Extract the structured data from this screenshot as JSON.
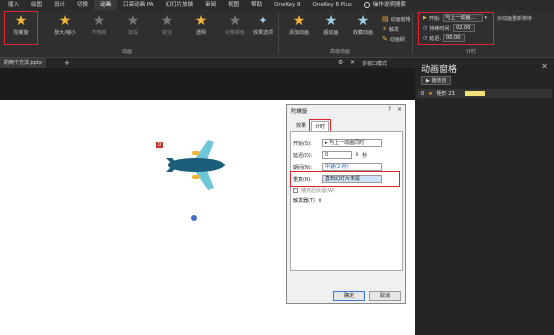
{
  "menubar": {
    "tabs": [
      "插入",
      "绘图",
      "设计",
      "切换",
      "动画",
      "口袋动画 PA",
      "幻灯片放映",
      "审阅",
      "视图",
      "帮助",
      "OneKey 8",
      "OneKey 8 Plus"
    ],
    "active_tab": "动画",
    "search_label": "操作说明搜索"
  },
  "ribbon": {
    "effects": [
      {
        "label": "陀螺旋",
        "state": "selected"
      },
      {
        "label": "放大/缩小",
        "state": "normal"
      },
      {
        "label": "不饱和",
        "state": "dim"
      },
      {
        "label": "加深",
        "state": "dim"
      },
      {
        "label": "变淡",
        "state": "dim"
      },
      {
        "label": "透明",
        "state": "normal"
      },
      {
        "label": "对象颜色",
        "state": "dim"
      }
    ],
    "effect_options_label": "效果选项",
    "group_animation": "动画",
    "add_animation_label": "添加动画",
    "animation_pane_label": "动画窗格",
    "trigger_label": "触发",
    "animation_painter_label": "动画刷",
    "group_advanced": "高级动画",
    "start_label": "开始:",
    "start_value": "与上一动画...",
    "duration_label": "持续时间:",
    "duration_value": "02.00",
    "delay_label": "延迟:",
    "delay_value": "00.00",
    "reorder_label": "对动画重新排序",
    "group_timing": "计时"
  },
  "document": {
    "tab_name": "的两个方法.pptx",
    "add_tab": "+",
    "multi_window_label": "多窗口模式",
    "animation_tag": "0"
  },
  "anim_pane": {
    "title": "动画窗格",
    "play_label": "播放自",
    "item_index": "0",
    "item_name": "矩形 23"
  },
  "dialog": {
    "title": "陀螺旋",
    "help": "?",
    "close": "×",
    "tabs": [
      "效果",
      "计时"
    ],
    "active_tab": "计时",
    "start_label": "开始(S):",
    "start_value": "与上一动画同时",
    "delay_label": "延迟(D):",
    "delay_value": "0",
    "delay_unit": "秒",
    "duration_label": "期间(N):",
    "duration_value": "中速(2 秒)",
    "repeat_label": "重复(R):",
    "repeat_value": "直到幻灯片末尾",
    "rewind_label": "播完后快退(W)",
    "triggers_label": "触发器(T)",
    "ok": "确定",
    "cancel": "取消"
  },
  "colors": {
    "highlight": "#e0242b",
    "star": "#f1b53a",
    "plane_body": "#1b5e79",
    "plane_wing": "#6ec6d8",
    "plane_engine": "#f1b53a",
    "anim_bar": "#f2e07a"
  }
}
